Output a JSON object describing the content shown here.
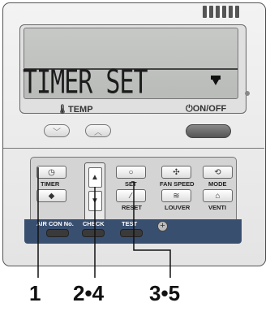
{
  "lcd": {
    "text": "TIMER SET",
    "indicator_icon": "arrow-down-flag-icon"
  },
  "labels": {
    "temp": "TEMP",
    "onoff": "ON/OFF"
  },
  "buttons": {
    "timer": "TIMER",
    "set": "SET",
    "fan_speed": "FAN SPEED",
    "mode": "MODE",
    "reset": "RESET",
    "louver": "LOUVER",
    "venti": "VENTI"
  },
  "strip": {
    "air_con_no": "AIR CON No.",
    "check": "CHECK",
    "test": "TEST"
  },
  "callouts": {
    "c1": "1",
    "c2": "2•4",
    "c3": "3•5"
  },
  "colors": {
    "strip": "#394f70",
    "lcd": "#c0c2c0"
  }
}
